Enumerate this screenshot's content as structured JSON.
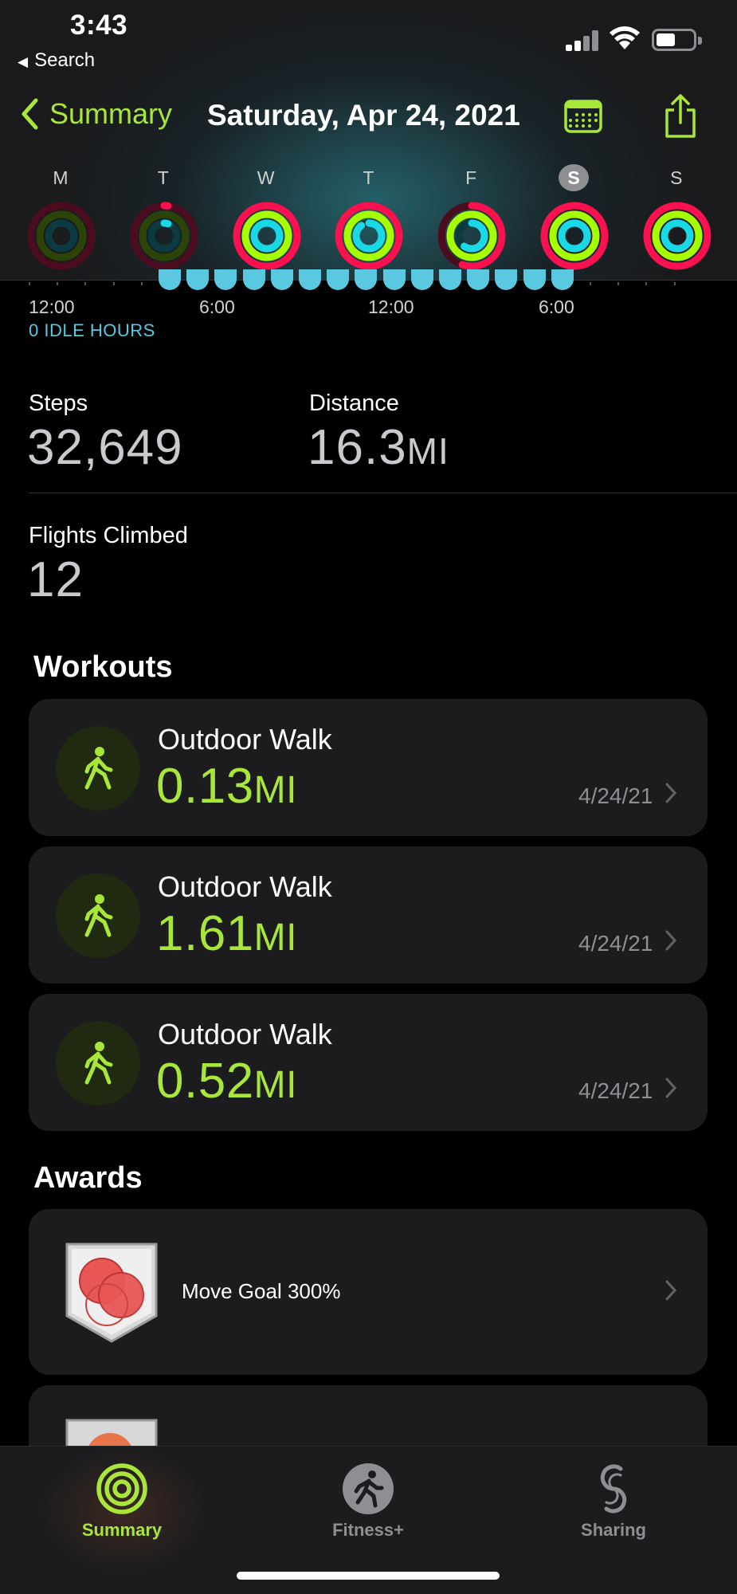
{
  "status_bar": {
    "time": "3:43",
    "back_app": "Search"
  },
  "nav": {
    "back_label": "Summary",
    "date": "Saturday, Apr 24, 2021"
  },
  "week": [
    {
      "letter": "M",
      "move": 0.0,
      "exercise": 0.0,
      "stand": 0.0,
      "selected": false
    },
    {
      "letter": "T",
      "move": 0.02,
      "exercise": 0.0,
      "stand": 0.05,
      "selected": false
    },
    {
      "letter": "W",
      "move": 1.0,
      "exercise": 1.0,
      "stand": 1.0,
      "selected": false
    },
    {
      "letter": "T",
      "move": 1.0,
      "exercise": 1.0,
      "stand": 0.9,
      "selected": false
    },
    {
      "letter": "F",
      "move": 0.55,
      "exercise": 1.0,
      "stand": 0.6,
      "selected": false
    },
    {
      "letter": "S",
      "move": 1.0,
      "exercise": 1.0,
      "stand": 1.0,
      "selected": true
    },
    {
      "letter": "S",
      "move": 1.0,
      "exercise": 1.0,
      "stand": 1.0,
      "selected": false
    }
  ],
  "hourly": {
    "labels": [
      "12:00",
      "6:00",
      "12:00",
      "6:00"
    ],
    "idle": "0 IDLE HOURS"
  },
  "stats": {
    "steps_label": "Steps",
    "steps_value": "32,649",
    "distance_label": "Distance",
    "distance_value": "16.3",
    "distance_unit": "MI",
    "flights_label": "Flights Climbed",
    "flights_value": "12"
  },
  "workouts_title": "Workouts",
  "workouts": [
    {
      "title": "Outdoor Walk",
      "distance": "0.13",
      "unit": "MI",
      "date": "4/24/21"
    },
    {
      "title": "Outdoor Walk",
      "distance": "1.61",
      "unit": "MI",
      "date": "4/24/21"
    },
    {
      "title": "Outdoor Walk",
      "distance": "0.52",
      "unit": "MI",
      "date": "4/24/21"
    }
  ],
  "awards_title": "Awards",
  "awards": [
    {
      "title": "Move Goal 300%"
    }
  ],
  "tabs": [
    {
      "label": "Summary",
      "icon": "activity-rings-icon",
      "active": true
    },
    {
      "label": "Fitness+",
      "icon": "runner-icon",
      "active": false
    },
    {
      "label": "Sharing",
      "icon": "sharing-icon",
      "active": false
    }
  ],
  "colors": {
    "accent": "#a8e63a",
    "move": "#fa114f",
    "exercise": "#a6ff00",
    "stand": "#19d9e6",
    "idle": "#5ac8e0"
  }
}
